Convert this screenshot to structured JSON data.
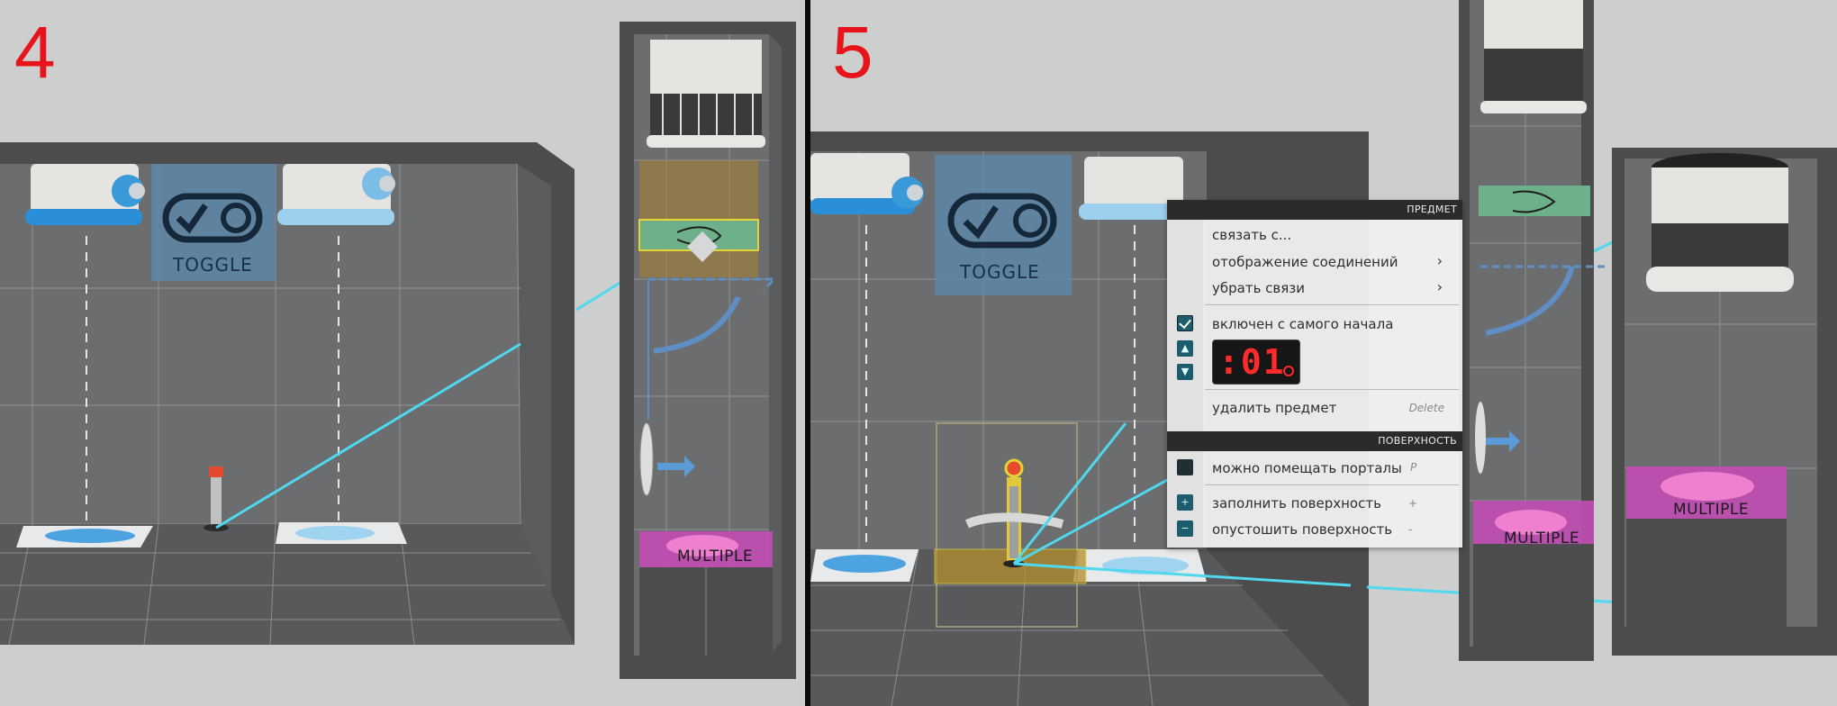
{
  "panels": {
    "left": {
      "step_number": "4",
      "toggle_label": "TOGGLE",
      "multiple_label": "MULTIPLE"
    },
    "right": {
      "step_number": "5",
      "toggle_label": "TOGGLE",
      "multiple_label_1": "MULTIPLE",
      "multiple_label_2": "MULTIPLE"
    }
  },
  "context_menu": {
    "item_section_title": "ПРЕДМЕТ",
    "link_to": "связать с...",
    "show_connections": "отображение соединений",
    "remove_links": "убрать связи",
    "enabled_from_start": "включен с самого начала",
    "enabled_from_start_checked": true,
    "timer_value": ":01",
    "delete_item": "удалить предмет",
    "delete_shortcut": "Delete",
    "surface_section_title": "ПОВЕРХНОСТЬ",
    "portals_allowed": "можно помещать порталы",
    "portals_shortcut": "P",
    "fill_surface": "заполнить поверхность",
    "fill_shortcut": "+",
    "clear_surface": "опустошить поверхность",
    "clear_shortcut": "-"
  },
  "colors": {
    "step_number": "#e8141c",
    "connection_line": "#4fd8ee",
    "menu_header": "#2b2b2b",
    "teal_accent": "#1d5c6d",
    "timer_digits": "#ff2b2b"
  }
}
